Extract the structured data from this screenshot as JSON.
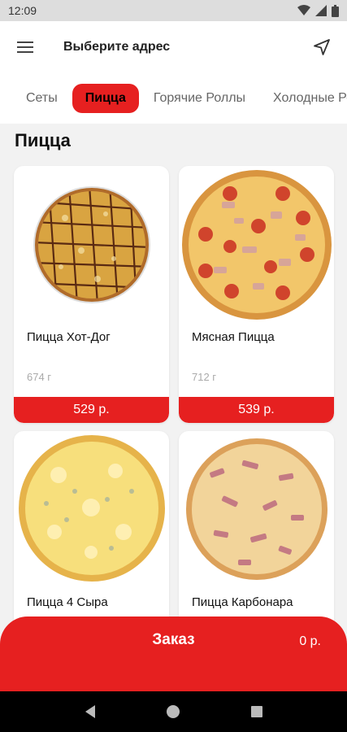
{
  "status_bar": {
    "time": "12:09"
  },
  "header": {
    "address_label": "Выберите адрес"
  },
  "categories": [
    {
      "label": "Сеты",
      "active": false
    },
    {
      "label": "Пицца",
      "active": true
    },
    {
      "label": "Горячие Роллы",
      "active": false
    },
    {
      "label": "Холодные Роллы",
      "active": false
    }
  ],
  "section": {
    "title": "Пицца"
  },
  "products": [
    {
      "name": "Пицца Хот-Дог",
      "weight": "674 г",
      "price": "529 р."
    },
    {
      "name": "Мясная Пицца",
      "weight": "712 г",
      "price": "539 р."
    },
    {
      "name": "Пицца 4 Сыра",
      "weight": "",
      "price": ""
    },
    {
      "name": "Пицца Карбонара",
      "weight": "",
      "price": ""
    }
  ],
  "order": {
    "label": "Заказ",
    "total": "0 р."
  },
  "colors": {
    "accent": "#e62020"
  }
}
